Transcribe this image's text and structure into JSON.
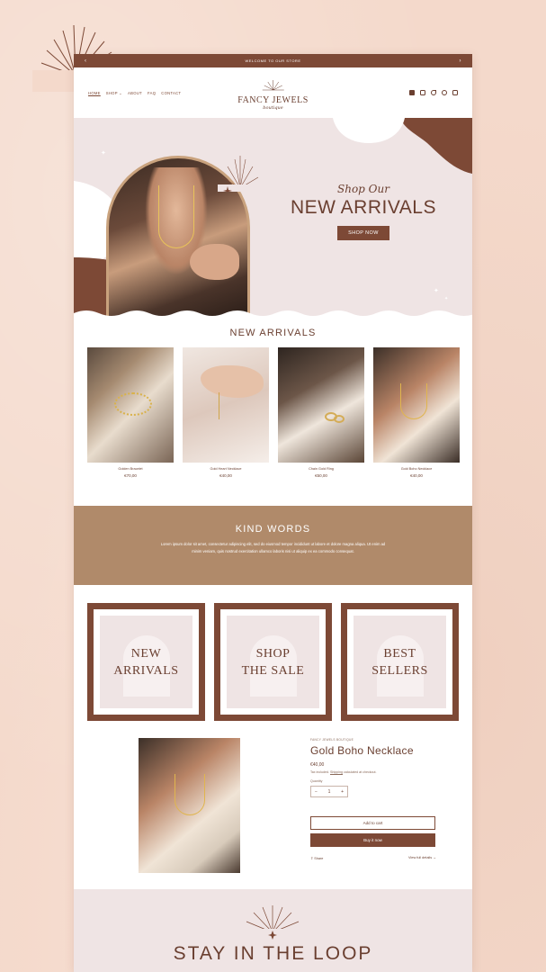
{
  "announcement": {
    "text": "WELCOME TO OUR STORE",
    "prev": "‹",
    "next": "›"
  },
  "nav": {
    "items": [
      "HOME",
      "SHOP ⌄",
      "ABOUT",
      "FAQ",
      "CONTACT"
    ]
  },
  "logo": {
    "brand": "FANCY JEWELS",
    "script": "boutique"
  },
  "header_icons": [
    "facebook-icon",
    "instagram-icon",
    "tiktok-icon",
    "search-icon",
    "cart-icon"
  ],
  "hero": {
    "script": "Shop Our",
    "title": "NEW ARRIVALS",
    "button": "SHOP NOW"
  },
  "arrivals": {
    "title": "NEW ARRIVALS",
    "products": [
      {
        "name": "Golden Bracelet",
        "price": "€70,00"
      },
      {
        "name": "Gold Heart Necklace",
        "price": "€40,00"
      },
      {
        "name": "Chain Gold Ring",
        "price": "€50,00"
      },
      {
        "name": "Gold Boho Necklace",
        "price": "€40,00"
      }
    ]
  },
  "kind_words": {
    "title": "KIND WORDS",
    "text": "Lorem ipsum dolor sit amet, consectetur adipiscing elit, sed do eiusmod tempor incididunt ut labore et dolore magna aliqua. Ut enim ad minim veniam, quis nostrud exercitation ullamco laboris nisi ut aliquip ex ea commodo consequat."
  },
  "collections": [
    {
      "line1": "NEW",
      "line2": "ARRIVALS"
    },
    {
      "line1": "SHOP",
      "line2": "THE SALE"
    },
    {
      "line1": "BEST",
      "line2": "SELLERS"
    }
  ],
  "featured": {
    "vendor": "FANCY JEWELS BOUTIQUE",
    "title": "Gold Boho Necklace",
    "price": "€40,00",
    "tax_prefix": "Tax included.",
    "tax_link": "Shipping",
    "tax_suffix": "calculated at checkout.",
    "quantity_label": "Quantity",
    "quantity": "1",
    "minus": "−",
    "plus": "+",
    "add_to_cart": "Add to cart",
    "buy_now": "Buy it now",
    "share": "⇪ Share",
    "view_details": "View full details →"
  },
  "newsletter": {
    "title": "STAY IN THE LOOP"
  },
  "colors": {
    "brown": "#7d4936",
    "tan": "#b08a6a",
    "blush": "#efe4e4",
    "background": "#f4d9cb"
  }
}
